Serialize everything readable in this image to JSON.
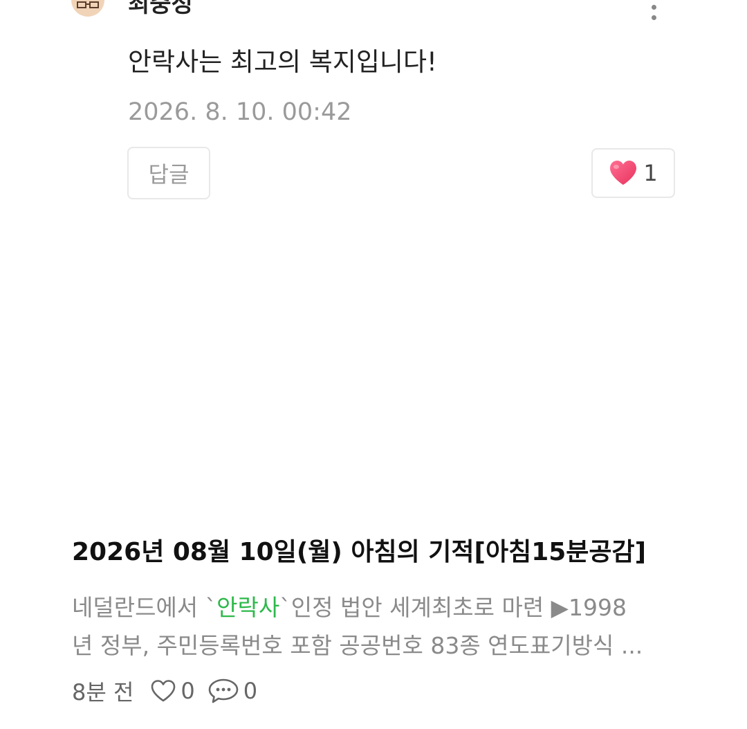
{
  "comment": {
    "author": "최중정",
    "text": "안락사는 최고의 복지입니다!",
    "date": "2026. 8. 10. 00:42",
    "reply_label": "답글",
    "like_count": "1",
    "more_icon": "more-vertical-icon",
    "like_icon": "heart-filled-icon"
  },
  "post": {
    "title": "2026년 08월 10일(월) 아침의 기적[아침15분공감]",
    "excerpt_line1_before": "네덜란드에서 `",
    "excerpt_highlight": "안락사",
    "excerpt_line1_after": "`인정 법안 세계최초로 마련 ▶1998",
    "excerpt_line2": "년 정부, 주민등록번호 포함 공공번호 83종 연도표기방식 ...",
    "time_ago": "8분 전",
    "like_count": "0",
    "comment_count": "0",
    "like_icon": "heart-outline-icon",
    "comment_icon": "speech-bubble-icon"
  },
  "colors": {
    "highlight": "#2cb84a",
    "heart": "#f0436e",
    "muted_text": "#9a9a9a"
  }
}
